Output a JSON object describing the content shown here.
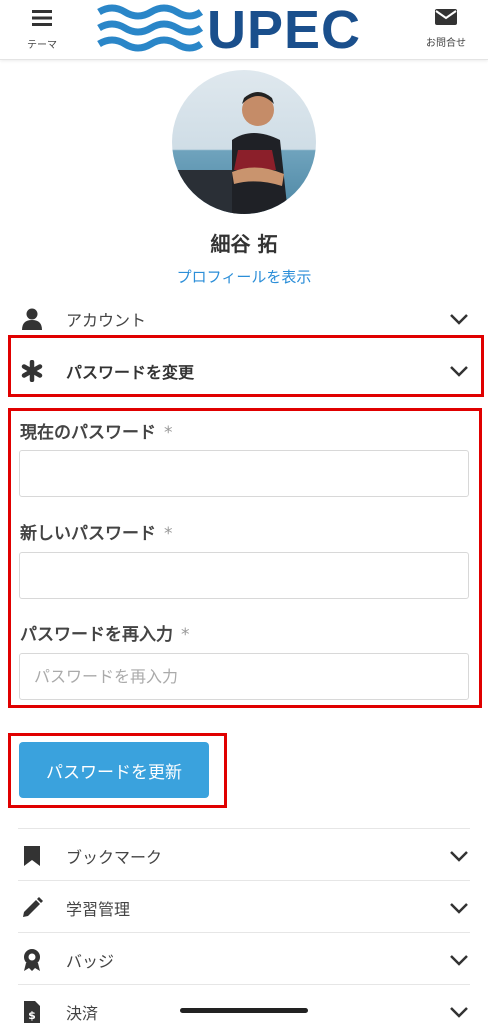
{
  "header": {
    "menu_label": "テーマ",
    "contact_label": "お問合せ",
    "logo_text": "UPEC",
    "brand_color": "#1a4f8c",
    "wave_color": "#2a86c8"
  },
  "profile": {
    "name": "細谷 拓",
    "view_profile_link": "プロフィールを表示"
  },
  "sections": {
    "account": "アカウント",
    "change_password": "パスワードを変更",
    "bookmark": "ブックマーク",
    "learning": "学習管理",
    "badge": "バッジ",
    "payment": "決済"
  },
  "password_form": {
    "current_label": "現在のパスワード",
    "new_label": "新しいパスワード",
    "reenter_label": "パスワードを再入力",
    "required_mark": "*",
    "reenter_placeholder": "パスワードを再入力",
    "submit_label": "パスワードを更新"
  },
  "colors": {
    "accent": "#3aa2dd",
    "link": "#2b8ed8",
    "highlight_box": "#e00000"
  }
}
